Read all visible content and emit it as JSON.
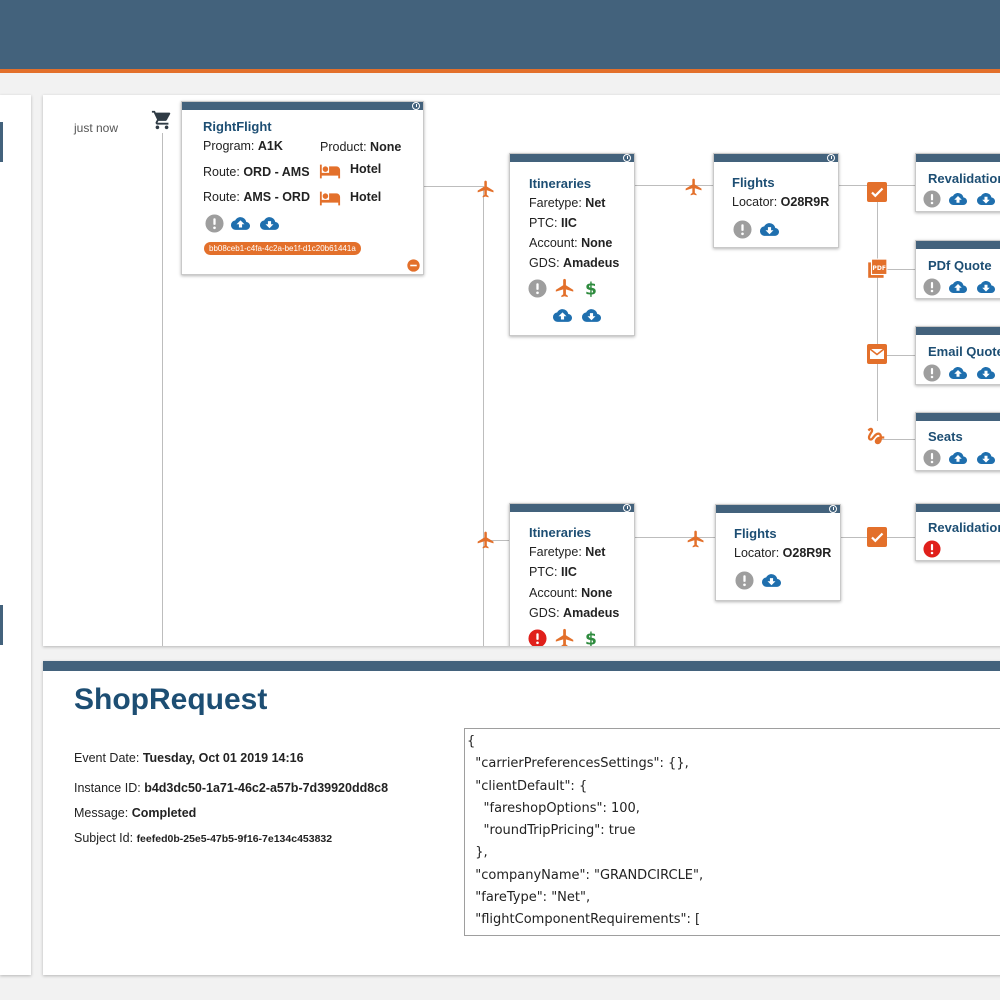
{
  "timeline": {
    "label": "just now"
  },
  "rightflight": {
    "title": "RightFlight",
    "program_label": "Program:",
    "program": "A1K",
    "product_label": "Product:",
    "product": "None",
    "route1_label": "Route:",
    "route1": "ORD - AMS",
    "route2_label": "Route:",
    "route2": "AMS - ORD",
    "hotel1": "Hotel",
    "hotel2": "Hotel",
    "guid": "bb08ceb1-c4fa-4c2a-be1f-d1c20b61441a"
  },
  "itineraries": [
    {
      "title": "Itineraries",
      "faretype_label": "Faretype:",
      "faretype": "Net",
      "ptc_label": "PTC:",
      "ptc": "IIC",
      "account_label": "Account:",
      "account": "None",
      "gds_label": "GDS:",
      "gds": "Amadeus"
    },
    {
      "title": "Itineraries",
      "faretype_label": "Faretype:",
      "faretype": "Net",
      "ptc_label": "PTC:",
      "ptc": "IIC",
      "account_label": "Account:",
      "account": "None",
      "gds_label": "GDS:",
      "gds": "Amadeus"
    }
  ],
  "flights": [
    {
      "title": "Flights",
      "locator_label": "Locator:",
      "locator": "O28R9R"
    },
    {
      "title": "Flights",
      "locator_label": "Locator:",
      "locator": "O28R9R"
    }
  ],
  "actions": {
    "revalidation1": "Revalidation",
    "pdf_quote": "PDf Quote",
    "email_quote": "Email Quote",
    "seats": "Seats",
    "revalidation2": "Revalidation"
  },
  "detail": {
    "title": "ShopRequest",
    "event_date_label": "Event Date:",
    "event_date": "Tuesday, Oct 01 2019 14:16",
    "instance_label": "Instance ID:",
    "instance_id": "b4d3dc50-1a71-46c2-a57b-7d39920dd8c8",
    "message_label": "Message:",
    "message": "Completed",
    "subject_label": "Subject Id:",
    "subject_id": "feefed0b-25e5-47b5-9f16-7e134c453832",
    "json_lines": [
      "{",
      "  \"carrierPreferencesSettings\": {},",
      "  \"clientDefault\": {",
      "    \"fareshopOptions\": 100,",
      "    \"roundTripPricing\": true",
      "  },",
      "  \"companyName\": \"GRANDCIRCLE\",",
      "  \"fareType\": \"Net\",",
      "  \"flightComponentRequirements\": ["
    ]
  },
  "colors": {
    "header": "#43627c",
    "accent": "#e3702b",
    "title": "#1d4e73",
    "cloud": "#1f6fae",
    "error": "#e0201b",
    "info": "#9e9e9e",
    "dollar": "#2e8b3e"
  }
}
